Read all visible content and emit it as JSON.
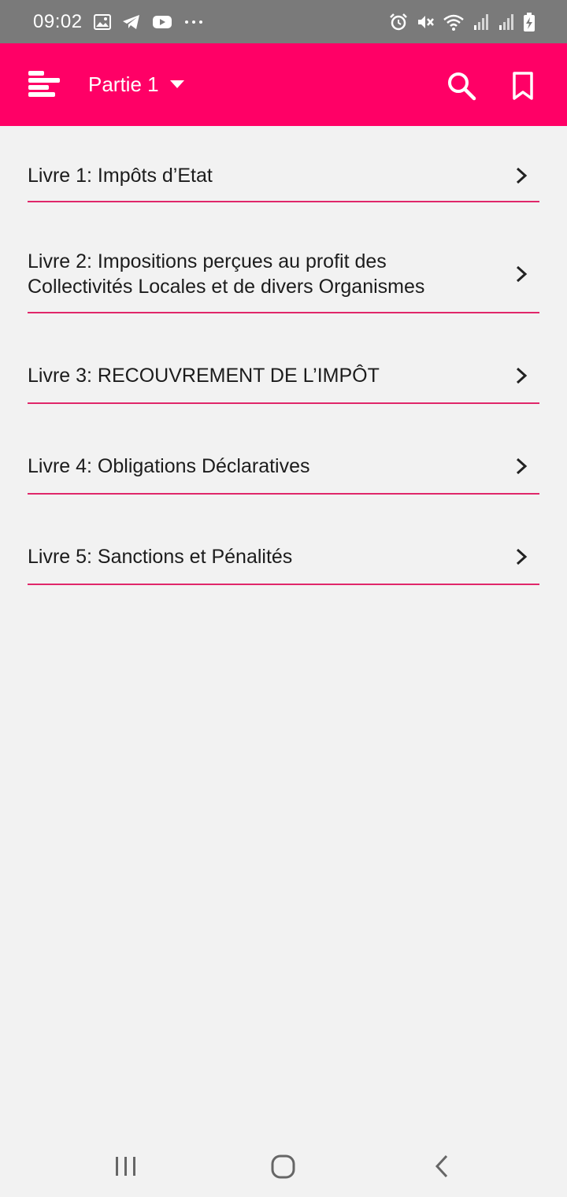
{
  "status_bar": {
    "time": "09:02",
    "icons_left": [
      "gallery-icon",
      "telegram-icon",
      "youtube-icon",
      "more-notifications-icon"
    ],
    "icons_right": [
      "alarm-icon",
      "mute-icon",
      "wifi-icon",
      "signal-icon",
      "signal-icon",
      "battery-charging-icon"
    ]
  },
  "app_bar": {
    "background": "#ff0066",
    "title": "Partie 1",
    "menu_icon": "menu-icon",
    "dropdown_icon": "caret-down-icon",
    "search_icon": "search-icon",
    "bookmark_icon": "bookmark-icon"
  },
  "list": {
    "divider_color": "#e0276a",
    "items": [
      {
        "label": "Livre 1: Impôts d’Etat"
      },
      {
        "label": "Livre 2: Impositions perçues au profit des Collectivités Locales et de divers Organismes"
      },
      {
        "label": "Livre 3: RECOUVREMENT DE L’IMPÔT"
      },
      {
        "label": "Livre 4: Obligations Déclaratives"
      },
      {
        "label": "Livre 5: Sanctions et Pénalités"
      }
    ]
  },
  "nav_bar": {
    "icons": [
      "recent-apps-icon",
      "home-icon",
      "back-icon"
    ]
  }
}
